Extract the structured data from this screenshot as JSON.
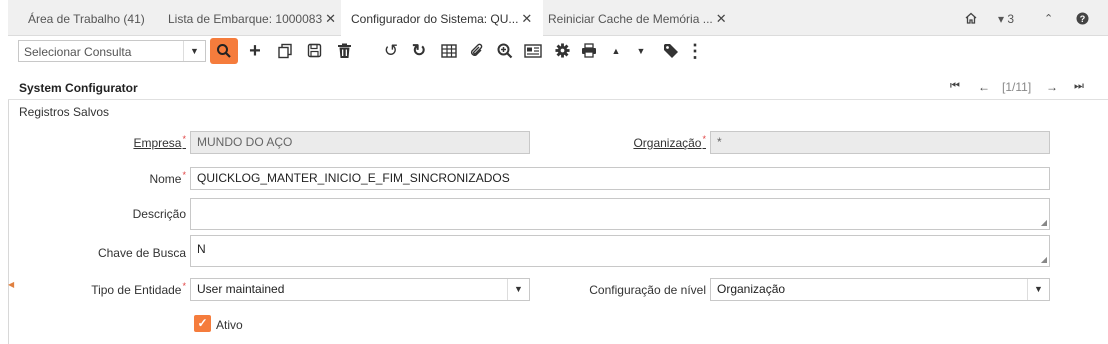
{
  "tabs": [
    {
      "label": "Área de Trabalho (41)",
      "closable": false
    },
    {
      "label": "Lista de Embarque: 1000083",
      "closable": true,
      "close": "✕"
    },
    {
      "label": "Configurador do Sistema: QU...",
      "closable": true,
      "close": "✕",
      "active": true
    },
    {
      "label": "Reiniciar Cache de Memória ...",
      "closable": true,
      "close": "✕"
    }
  ],
  "tab_right": {
    "home_icon": "home-icon",
    "count": "▾ 3",
    "collapse_icon": "double-chevron-up-icon",
    "help_icon": "help-icon"
  },
  "toolbar": {
    "query_placeholder": "Selecionar Consulta",
    "icons": [
      "search-icon",
      "add-icon",
      "copy-icon",
      "save-icon",
      "delete-icon",
      "undo-icon",
      "refresh-icon",
      "grid-toggle-icon",
      "attachment-icon",
      "zoom-in-icon",
      "report-icon",
      "settings-icon",
      "print-icon",
      "previous-record-icon",
      "next-record-icon",
      "tag-icon",
      "more-menu-icon"
    ]
  },
  "header": {
    "title": "System Configurator",
    "record_position": "1/11"
  },
  "subtitle": "Registros Salvos",
  "form": {
    "empresa": {
      "label": "Empresa",
      "value": "MUNDO DO AÇO"
    },
    "organizacao": {
      "label": "Organização",
      "value": "*"
    },
    "nome": {
      "label": "Nome",
      "value": "QUICKLOG_MANTER_INICIO_E_FIM_SINCRONIZADOS"
    },
    "descricao": {
      "label": "Descrição",
      "value": ""
    },
    "chave": {
      "label": "Chave de Busca",
      "value": "N"
    },
    "tipo": {
      "label": "Tipo de Entidade",
      "value": "User maintained"
    },
    "config_nivel": {
      "label": "Configuração de nível",
      "value": "Organização"
    },
    "ativo": {
      "label": "Ativo",
      "checked": true
    }
  },
  "colors": {
    "accent": "#f57c3c",
    "required": "#e04040"
  }
}
